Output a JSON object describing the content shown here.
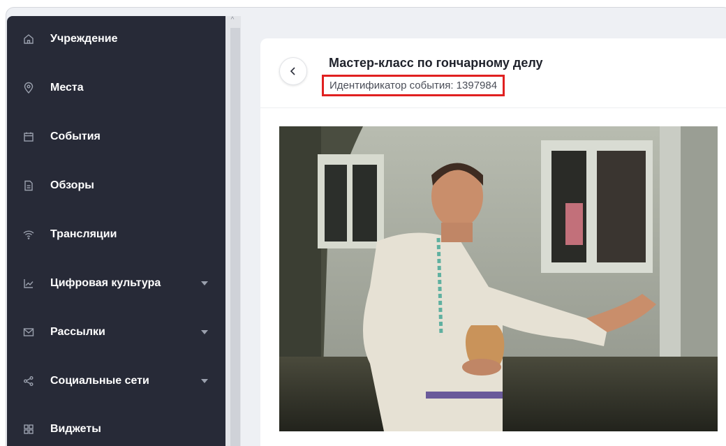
{
  "sidebar": {
    "items": [
      {
        "label": "Учреждение",
        "icon": "home-icon",
        "has_dropdown": false
      },
      {
        "label": "Места",
        "icon": "location-pin-icon",
        "has_dropdown": false
      },
      {
        "label": "События",
        "icon": "calendar-icon",
        "has_dropdown": false
      },
      {
        "label": "Обзоры",
        "icon": "document-icon",
        "has_dropdown": false
      },
      {
        "label": "Трансляции",
        "icon": "wifi-icon",
        "has_dropdown": false
      },
      {
        "label": "Цифровая культура",
        "icon": "chart-line-icon",
        "has_dropdown": true
      },
      {
        "label": "Рассылки",
        "icon": "mail-icon",
        "has_dropdown": true
      },
      {
        "label": "Социальные сети",
        "icon": "share-icon",
        "has_dropdown": true
      },
      {
        "label": "Виджеты",
        "icon": "grid-icon",
        "has_dropdown": false
      }
    ]
  },
  "event": {
    "title": "Мастер-класс по гончарному делу",
    "id_label": "Идентификатор события: 1397984"
  },
  "colors": {
    "sidebar_bg": "#272a37",
    "highlight_border": "#e02020",
    "content_bg": "#eef0f4"
  }
}
